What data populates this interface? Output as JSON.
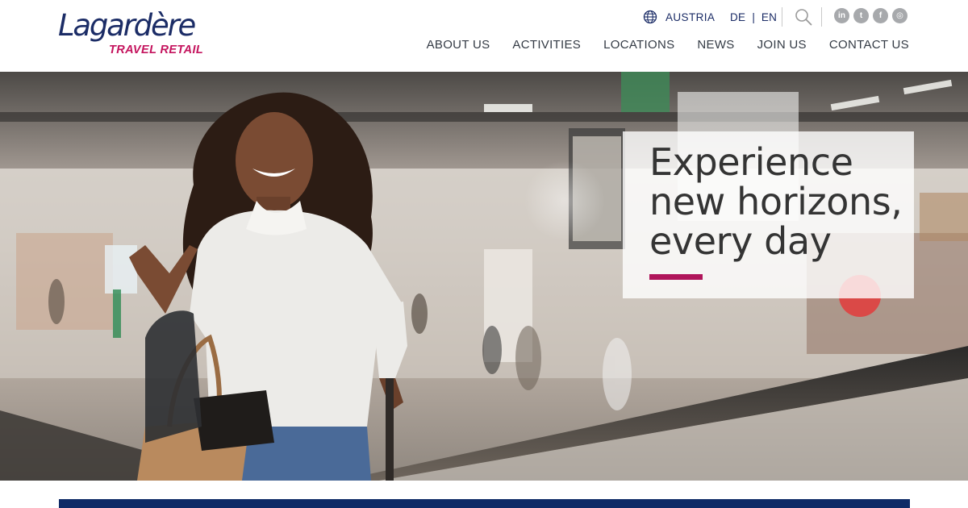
{
  "brand": {
    "name": "Lagardère",
    "tagline": "TRAVEL RETAIL",
    "primary_color": "#1b2c66",
    "accent_color": "#c4135d"
  },
  "topbar": {
    "country_icon": "globe-icon",
    "country": "AUSTRIA",
    "languages": [
      "DE",
      "EN"
    ],
    "language_separator": "|",
    "search_icon": "search-icon",
    "socials": [
      {
        "name": "linkedin-icon",
        "glyph": "in"
      },
      {
        "name": "twitter-icon",
        "glyph": "t"
      },
      {
        "name": "facebook-icon",
        "glyph": "f"
      },
      {
        "name": "instagram-icon",
        "glyph": "◎"
      }
    ]
  },
  "nav": {
    "items": [
      "ABOUT US",
      "ACTIVITIES",
      "LOCATIONS",
      "NEWS",
      "JOIN US",
      "CONTACT US"
    ]
  },
  "hero": {
    "title_lines": [
      "Experience",
      "new horizons,",
      "every day"
    ],
    "accent_color": "#b0155b"
  },
  "footer_bar": {
    "color": "#0e2a66"
  }
}
